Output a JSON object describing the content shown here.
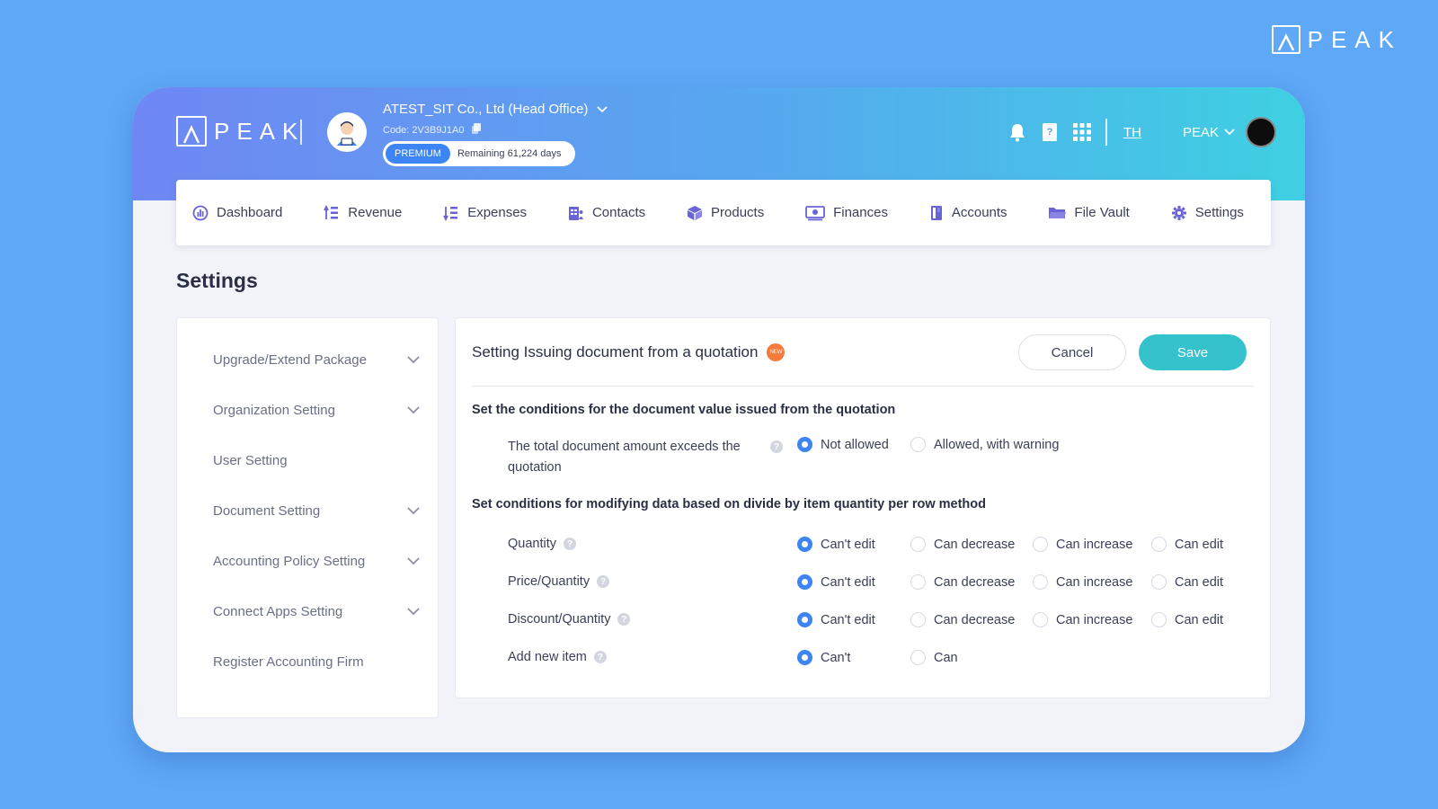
{
  "brand": {
    "logo_text": "PEAK",
    "accent": "#3d85f4",
    "teal": "#35c2cc"
  },
  "header": {
    "company_name": "ATEST_SIT Co., Ltd (Head Office)",
    "company_code": "Code: 2V3B9J1A0",
    "package_badge": "PREMIUM",
    "remaining": "Remaining 61,224 days",
    "language": "TH",
    "user_name": "PEAK",
    "icons": [
      "bell-icon",
      "help-book-icon",
      "apps-grid-icon"
    ]
  },
  "nav": [
    {
      "label": "Dashboard",
      "icon": "dashboard-icon"
    },
    {
      "label": "Revenue",
      "icon": "revenue-icon"
    },
    {
      "label": "Expenses",
      "icon": "expenses-icon"
    },
    {
      "label": "Contacts",
      "icon": "contacts-icon"
    },
    {
      "label": "Products",
      "icon": "products-icon"
    },
    {
      "label": "Finances",
      "icon": "finances-icon"
    },
    {
      "label": "Accounts",
      "icon": "accounts-icon"
    },
    {
      "label": "File Vault",
      "icon": "folder-icon"
    },
    {
      "label": "Settings",
      "icon": "gear-icon"
    }
  ],
  "page_title": "Settings",
  "sidebar": [
    {
      "label": "Upgrade/Extend Package",
      "expandable": true
    },
    {
      "label": "Organization Setting",
      "expandable": true
    },
    {
      "label": "User Setting",
      "expandable": false
    },
    {
      "label": "Document Setting",
      "expandable": true
    },
    {
      "label": "Accounting Policy Setting",
      "expandable": true
    },
    {
      "label": "Connect Apps Setting",
      "expandable": true
    },
    {
      "label": "Register Accounting Firm",
      "expandable": false
    }
  ],
  "panel": {
    "title": "Setting Issuing document from a quotation",
    "new_badge": "NEW",
    "cancel_label": "Cancel",
    "save_label": "Save",
    "section1_title": "Set the conditions for the document value issued from the quotation",
    "section1_row": {
      "label_line1": "The total document amount exceeds the",
      "label_line2": "quotation",
      "options": [
        "Not allowed",
        "Allowed, with warning"
      ],
      "selected": "Not allowed"
    },
    "section2_title": "Set conditions for modifying data based on divide by item quantity per row method",
    "rows": [
      {
        "label": "Quantity",
        "options": [
          "Can't edit",
          "Can decrease",
          "Can increase",
          "Can edit"
        ],
        "selected": "Can't edit"
      },
      {
        "label": "Price/Quantity",
        "options": [
          "Can't edit",
          "Can decrease",
          "Can increase",
          "Can edit"
        ],
        "selected": "Can't edit"
      },
      {
        "label": "Discount/Quantity",
        "options": [
          "Can't edit",
          "Can decrease",
          "Can increase",
          "Can edit"
        ],
        "selected": "Can't edit"
      },
      {
        "label": "Add new item",
        "options": [
          "Can't",
          "Can"
        ],
        "selected": "Can't"
      }
    ]
  }
}
